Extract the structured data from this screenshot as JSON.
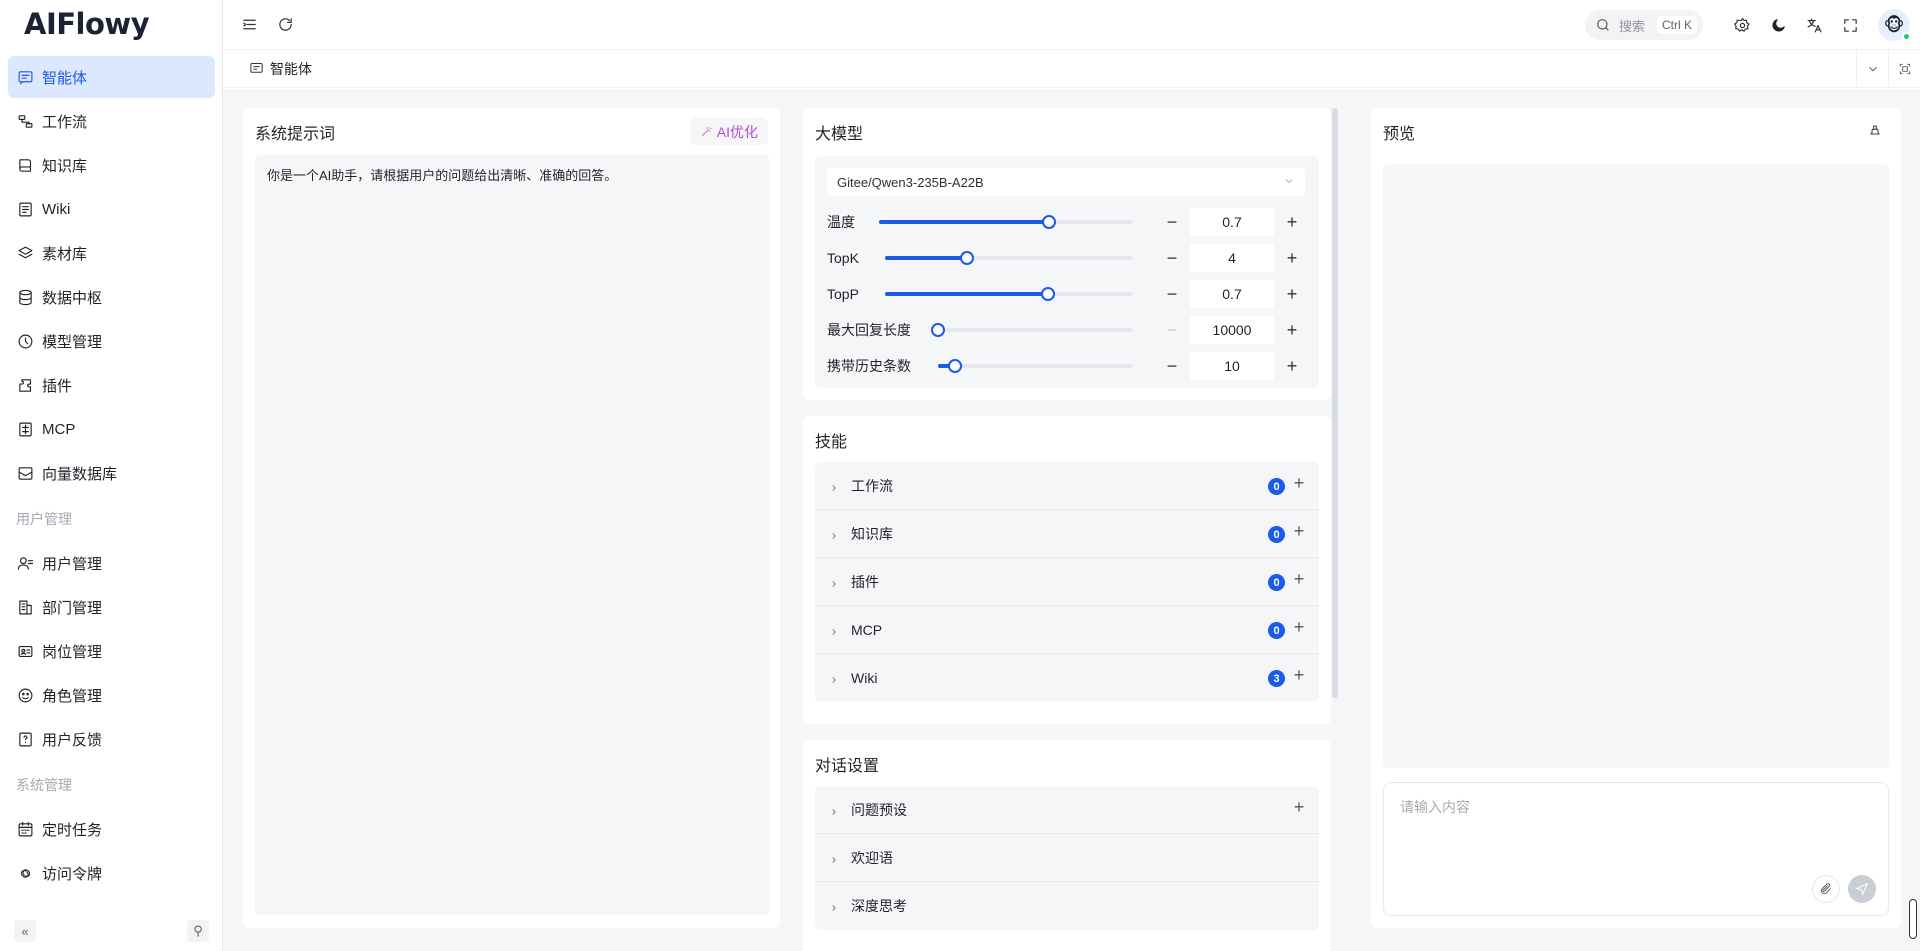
{
  "app": {
    "logo": "AIFlowy"
  },
  "sidebar": {
    "items": [
      {
        "label": "智能体",
        "icon": "chat-icon",
        "active": true
      },
      {
        "label": "工作流",
        "icon": "workflow-icon"
      },
      {
        "label": "知识库",
        "icon": "book-icon"
      },
      {
        "label": "Wiki",
        "icon": "doc-icon"
      },
      {
        "label": "素材库",
        "icon": "layers-icon"
      },
      {
        "label": "数据中枢",
        "icon": "database-icon"
      },
      {
        "label": "模型管理",
        "icon": "model-icon"
      },
      {
        "label": "插件",
        "icon": "plugin-icon"
      },
      {
        "label": "MCP",
        "icon": "mcp-icon"
      },
      {
        "label": "向量数据库",
        "icon": "vector-db-icon"
      }
    ],
    "group_user": "用户管理",
    "user_items": [
      {
        "label": "用户管理",
        "icon": "user-icon"
      },
      {
        "label": "部门管理",
        "icon": "department-icon"
      },
      {
        "label": "岗位管理",
        "icon": "position-icon"
      },
      {
        "label": "角色管理",
        "icon": "role-icon"
      },
      {
        "label": "用户反馈",
        "icon": "feedback-icon"
      }
    ],
    "group_system": "系统管理",
    "system_items": [
      {
        "label": "定时任务",
        "icon": "calendar-icon"
      },
      {
        "label": "访问令牌",
        "icon": "token-icon"
      }
    ]
  },
  "topbar": {
    "search_placeholder": "搜索",
    "search_shortcut": "Ctrl K"
  },
  "tab": {
    "label": "智能体"
  },
  "prompt": {
    "title": "系统提示词",
    "ai_optimize": "AI优化",
    "text": "你是一个AI助手，请根据用户的问题给出清晰、准确的回答。"
  },
  "model": {
    "title": "大模型",
    "selected": "Gitee/Qwen3-235B-A22B",
    "params": [
      {
        "label": "温度",
        "value": "0.7",
        "fraction": 0.67
      },
      {
        "label": "TopK",
        "value": "4",
        "fraction": 0.33
      },
      {
        "label": "TopP",
        "value": "0.7",
        "fraction": 0.66
      },
      {
        "label": "最大回复长度",
        "value": "10000",
        "fraction": 0.0
      },
      {
        "label": "携带历史条数",
        "value": "10",
        "fraction": 0.09
      }
    ]
  },
  "skills": {
    "title": "技能",
    "items": [
      {
        "label": "工作流",
        "count": "0"
      },
      {
        "label": "知识库",
        "count": "0"
      },
      {
        "label": "插件",
        "count": "0"
      },
      {
        "label": "MCP",
        "count": "0"
      },
      {
        "label": "Wiki",
        "count": "3"
      }
    ]
  },
  "dialog": {
    "title": "对话设置",
    "items": [
      {
        "label": "问题预设"
      },
      {
        "label": "欢迎语"
      },
      {
        "label": "深度思考"
      }
    ]
  },
  "preview": {
    "title": "预览",
    "input_placeholder": "请输入内容"
  },
  "colors": {
    "accent": "#1d5ae8",
    "active_bg": "#dbe8ff",
    "panel_bg": "#f5f6f8"
  }
}
